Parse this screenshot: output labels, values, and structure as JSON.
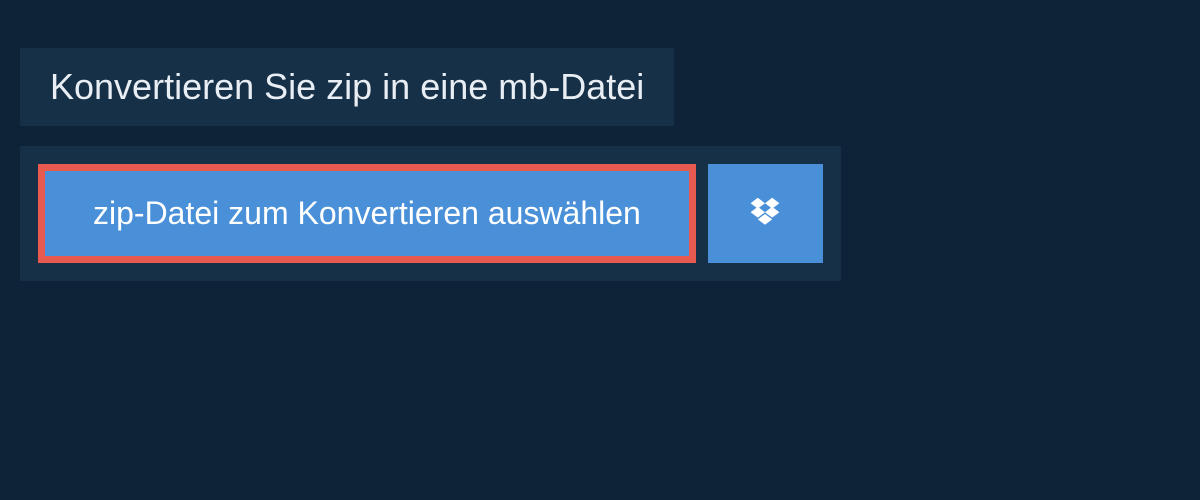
{
  "header": {
    "title": "Konvertieren Sie zip in eine mb-Datei"
  },
  "upload": {
    "select_button_label": "zip-Datei zum Konvertieren auswählen",
    "dropbox_icon_name": "dropbox-icon"
  },
  "colors": {
    "background": "#0f2338",
    "panel": "#163048",
    "button": "#4a90d9",
    "highlight_border": "#e85a4f",
    "text_light": "#e8eef3"
  }
}
